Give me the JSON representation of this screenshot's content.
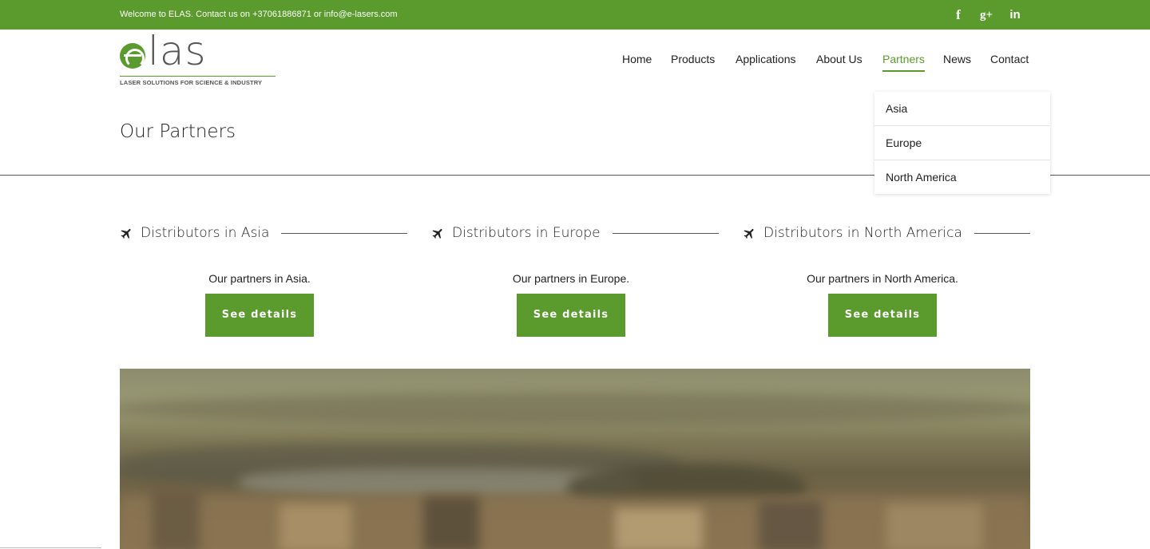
{
  "topbar": {
    "welcome_text": "Welcome to ELAS. Contact us on +37061886871 or info@e-lasers.com",
    "social": [
      {
        "icon": "facebook-icon",
        "glyph": "f"
      },
      {
        "icon": "google-plus-icon",
        "glyph": "g+"
      },
      {
        "icon": "linkedin-icon",
        "glyph": "in"
      }
    ]
  },
  "logo": {
    "wordmark": "las",
    "tagline": "LASER SOLUTIONS FOR SCIENCE & INDUSTRY"
  },
  "nav": {
    "items": [
      "Home",
      "Products",
      "Applications",
      "About Us",
      "Partners",
      "News",
      "Contact"
    ],
    "active": "Partners"
  },
  "dropdown": {
    "items": [
      "Asia",
      "Europe",
      "North America"
    ]
  },
  "page": {
    "title": "Our Partners"
  },
  "columns": [
    {
      "title": "Distributors in Asia",
      "text": "Our partners in Asia.",
      "button": "See details"
    },
    {
      "title": "Distributors in Europe",
      "text": "Our partners in Europe.",
      "button": "See details"
    },
    {
      "title": "Distributors in North America",
      "text": "Our partners in North America.",
      "button": "See details"
    }
  ],
  "colors": {
    "brand_green": "#5b9a2c",
    "text": "#222222"
  }
}
